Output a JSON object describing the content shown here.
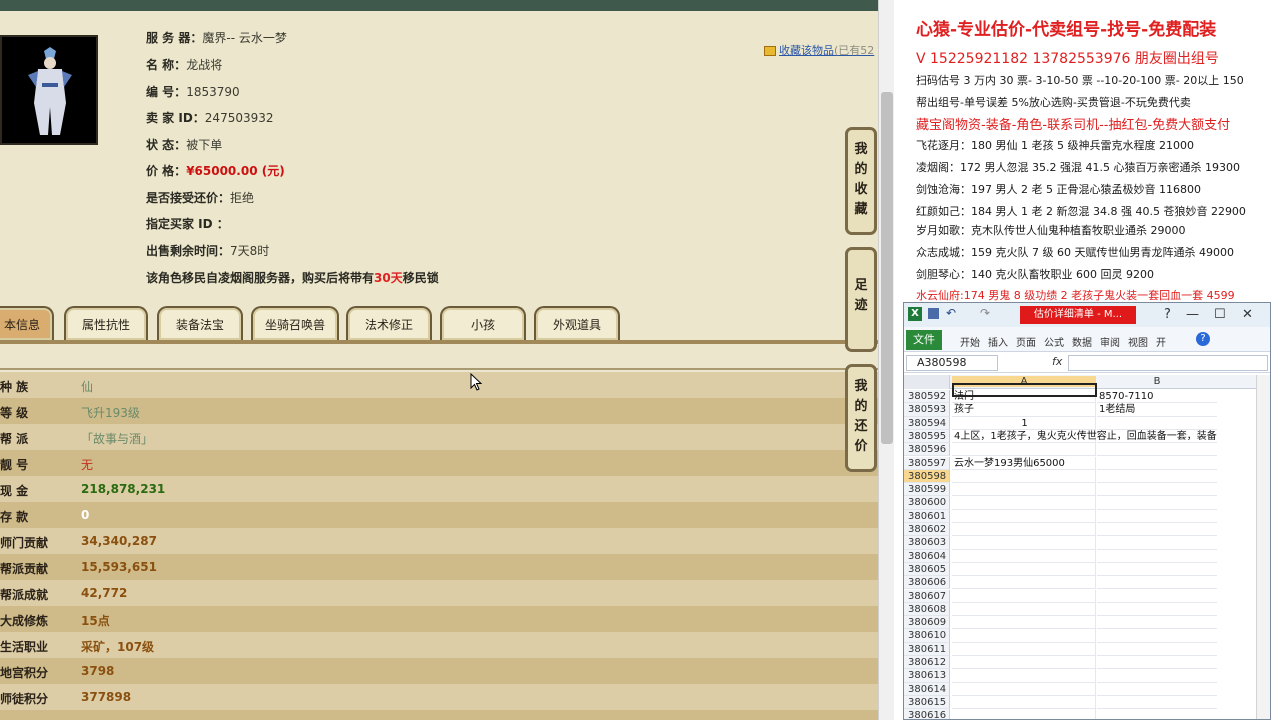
{
  "info": {
    "server_label": "服 务 器：",
    "server_value": "魔界-- 云水一梦",
    "name_label": "名        称：",
    "name_value": "龙战将",
    "id_label": "编        号：",
    "id_value": "1853790",
    "seller_label": "卖   家   ID：",
    "seller_value": "247503932",
    "status_label": "状        态：",
    "status_value": "被下单",
    "price_label": "价        格：",
    "price_value": "¥65000.00 (元)",
    "bargain_label": "是否接受还价：",
    "bargain_value": "拒绝",
    "buyer_label": "指定买家 ID ：",
    "buyer_value": "",
    "remain_label": "出售剩余时间：",
    "remain_value": "7天8时",
    "migrate_prefix": "该角色移民自凌烟阁服务器，购买后将带有",
    "migrate_days": "30天",
    "migrate_suffix": "移民锁",
    "fav_link": "收藏该物品",
    "fav_count": "(已有52"
  },
  "tabs": [
    "本信息",
    "属性抗性",
    "装备法宝",
    "坐骑召唤兽",
    "法术修正",
    "小孩",
    "外观道具"
  ],
  "attrs": [
    {
      "k": "种        族",
      "v": "仙"
    },
    {
      "k": "等        级",
      "v": "飞升193级"
    },
    {
      "k": "帮        派",
      "v": "「故事与酒」"
    },
    {
      "k": "靓        号",
      "v": "无"
    },
    {
      "k": "现        金",
      "v": "218,878,231"
    },
    {
      "k": "存        款",
      "v": "0"
    },
    {
      "k": "师门贡献",
      "v": "34,340,287"
    },
    {
      "k": "帮派贡献",
      "v": "15,593,651"
    },
    {
      "k": "帮派成就",
      "v": "42,772"
    },
    {
      "k": "大成修炼",
      "v": "15点"
    },
    {
      "k": "生活职业",
      "v": "采矿，107级"
    },
    {
      "k": "地宫积分",
      "v": "3798"
    },
    {
      "k": "师徒积分",
      "v": "377898"
    }
  ],
  "side_buttons": {
    "fav": "我的收藏",
    "foot": "足迹",
    "bargain": "我的还价"
  },
  "doc": {
    "title": "心猿-专业估价-代卖组号-找号-免费配装",
    "phone": "V 15225921182    13782553976 朋友圈出组号",
    "lines": [
      "扫码估号 3 万内 30 票- 3-10-50 票  --10-20-100 票- 20以上 150",
      "帮出组号-单号误差 5%放心选购-买贵管退-不玩免费代卖",
      "藏宝阁物资-装备-角色-联系司机--抽红包-免费大额支付",
      "飞花逐月：180 男仙 1 老孩 5 级神兵雷克水程度 21000",
      "凌烟阁：172 男人忽混 35.2 强混 41.5 心猿百万亲密通杀 19300",
      "剑蚀沧海：197 男人 2 老 5 正骨混心猿孟极妙音 116800",
      "红颜如己：184 男人 1 老 2 新忽混 34.8 强 40.5 苍狼妙音 22900",
      "岁月如歌：克木队传世人仙鬼种植畜牧职业通杀 29000",
      "众志成城：159 克火队 7 级 60 天赋传世仙男青龙阵通杀 49000",
      "剑胆琴心：140 克火队畜牧职业 600 回灵 9200",
      "水云仙府:174 男鬼 8 级功绩 2 老孩子鬼火装一套回血一套 4599"
    ]
  },
  "excel": {
    "title": "估价详细清单 - M...",
    "file_tab": "文件",
    "ribbon_tabs": [
      "开始",
      "插入",
      "页面",
      "公式",
      "数据",
      "审阅",
      "视图",
      "开"
    ],
    "namebox": "A380598",
    "fx": "fx",
    "col_a": "A",
    "col_b": "B",
    "rows": [
      {
        "n": "380592",
        "a": "法门",
        "b": "8570-7110"
      },
      {
        "n": "380593",
        "a": "孩子",
        "b": "1老结局"
      },
      {
        "n": "380594",
        "a": "1",
        "b": ""
      },
      {
        "n": "380595",
        "a": "4上区，1老孩子，鬼火克火传世容止，回血装备一套，装备",
        "b": ""
      },
      {
        "n": "380596",
        "a": "",
        "b": ""
      },
      {
        "n": "380597",
        "a": "云水一梦193男仙65000",
        "b": ""
      },
      {
        "n": "380598",
        "a": "",
        "b": ""
      },
      {
        "n": "380599",
        "a": "",
        "b": ""
      },
      {
        "n": "380600",
        "a": "",
        "b": ""
      },
      {
        "n": "380601",
        "a": "",
        "b": ""
      },
      {
        "n": "380602",
        "a": "",
        "b": ""
      },
      {
        "n": "380603",
        "a": "",
        "b": ""
      },
      {
        "n": "380604",
        "a": "",
        "b": ""
      },
      {
        "n": "380605",
        "a": "",
        "b": ""
      },
      {
        "n": "380606",
        "a": "",
        "b": ""
      },
      {
        "n": "380607",
        "a": "",
        "b": ""
      },
      {
        "n": "380608",
        "a": "",
        "b": ""
      },
      {
        "n": "380609",
        "a": "",
        "b": ""
      },
      {
        "n": "380610",
        "a": "",
        "b": ""
      },
      {
        "n": "380611",
        "a": "",
        "b": ""
      },
      {
        "n": "380612",
        "a": "",
        "b": ""
      },
      {
        "n": "380613",
        "a": "",
        "b": ""
      },
      {
        "n": "380614",
        "a": "",
        "b": ""
      },
      {
        "n": "380615",
        "a": "",
        "b": ""
      },
      {
        "n": "380616",
        "a": "",
        "b": ""
      }
    ]
  }
}
